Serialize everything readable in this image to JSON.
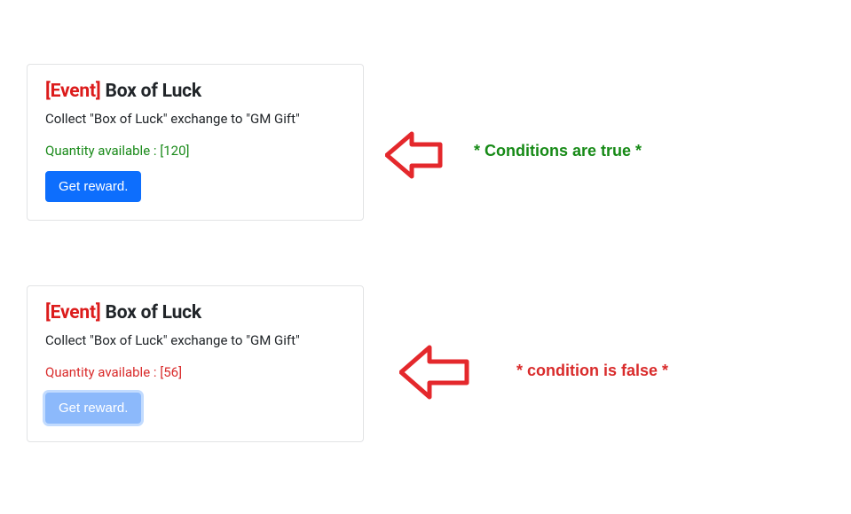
{
  "cards": [
    {
      "event_tag": "[Event]",
      "title": "Box of Luck",
      "description": "Collect \"Box of Luck\" exchange to \"GM Gift\"",
      "quantity_label": "Quantity available :",
      "quantity_value": "[120]",
      "quantity_state": "ok",
      "button_label": "Get reward.",
      "button_enabled": true
    },
    {
      "event_tag": "[Event]",
      "title": "Box of Luck",
      "description": "Collect \"Box of Luck\" exchange to \"GM Gift\"",
      "quantity_label": "Quantity available :",
      "quantity_value": "[56]",
      "quantity_state": "bad",
      "button_label": "Get reward.",
      "button_enabled": false
    }
  ],
  "annotations": {
    "true_label": "* Conditions are true *",
    "false_label": "* condition is false *"
  },
  "colors": {
    "event_tag": "#dc1c1c",
    "quantity_ok": "#1a8a1a",
    "quantity_bad": "#d92b2b",
    "button_primary": "#0d6efd",
    "button_disabled_bg": "#8cb9fb",
    "annotation_true": "#168a16",
    "annotation_false": "#d92b2b",
    "arrow": "#e4282c"
  }
}
